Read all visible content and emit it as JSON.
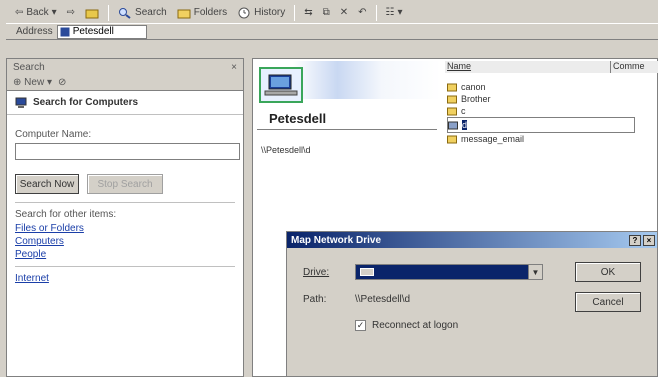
{
  "toolbar": {
    "back_label": "Back",
    "search_label": "Search",
    "folders_label": "Folders",
    "history_label": "History"
  },
  "address": {
    "label": "Address",
    "value": "Petesdell"
  },
  "search_pane": {
    "title": "Search",
    "close_glyph": "×",
    "new_label": "New",
    "heading": "Search for Computers",
    "computer_name_label": "Computer Name:",
    "computer_name_value": "",
    "search_now_label": "Search Now",
    "stop_search_label": "Stop Search",
    "other_items_label": "Search for other items:",
    "links": [
      "Files or Folders",
      "Computers",
      "People",
      "Internet"
    ]
  },
  "main": {
    "hostname": "Petesdell",
    "unc_path": "\\\\Petesdell\\d",
    "columns": [
      "Name",
      "Comme"
    ],
    "shares": [
      {
        "name": "canon"
      },
      {
        "name": "Brother"
      },
      {
        "name": "c"
      },
      {
        "name": "d"
      },
      {
        "name": "message_email"
      }
    ]
  },
  "dialog": {
    "title": "Map Network Drive",
    "drive_label": "Drive:",
    "drive_value": "",
    "path_label": "Path:",
    "path_value": "\\\\Petesdell\\d",
    "reconnect_label": "Reconnect at logon",
    "reconnect_checked": true,
    "ok_label": "OK",
    "cancel_label": "Cancel",
    "help_glyph": "?",
    "close_glyph": "×"
  }
}
